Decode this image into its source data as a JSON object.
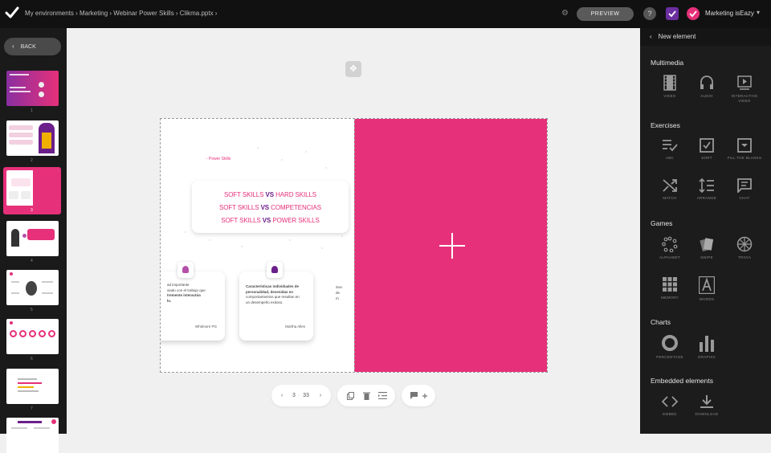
{
  "topbar": {
    "breadcrumb": "My environments › Marketing › Webinar Power Skills › Clikma.pptx ›",
    "preview_label": "PREVIEW",
    "help_label": "?",
    "user_name": "Marketing isEazy"
  },
  "left_panel": {
    "back_label": "BACK",
    "slides": [
      {
        "num": "1"
      },
      {
        "num": "2"
      },
      {
        "num": "3"
      },
      {
        "num": "4"
      },
      {
        "num": "5"
      },
      {
        "num": "6"
      },
      {
        "num": "7"
      }
    ]
  },
  "slide": {
    "tag": "- Power Skills",
    "line1_a": "SOFT SKILLS ",
    "line1_b": "VS",
    "line1_c": " HARD SKILLS",
    "line2_a": "SOFT SKILLS ",
    "line2_b": "VS",
    "line2_c": " COMPETENCIAS",
    "line3_a": "SOFT SKILLS ",
    "line3_b": "VS",
    "line3_c": " POWER SKILLS",
    "card1_text1": "ad importante",
    "card1_text2": "viado con el trabajo que",
    "card1_text3": "tremente interactúa",
    "card1_text4": "lo.",
    "card1_author": "Whitmore PG",
    "card2_text1": "Características individuales de",
    "card2_text2": "personalidad, devenidas en",
    "card2_text3": "comportamientos que resultan en",
    "card2_text4": "un desempeño exitoso.",
    "card2_author": "Martha Alles",
    "card3_text1": "Son",
    "card3_text2": "de",
    "card3_text3": "m"
  },
  "pager": {
    "current": "3",
    "total": "33"
  },
  "right_panel": {
    "header": "New element",
    "sections": {
      "multimedia": "Multimedia",
      "exercises": "Exercises",
      "games": "Games",
      "charts": "Charts",
      "embedded": "Embedded elements"
    },
    "tools": {
      "video": "VIDEO",
      "audio": "AUDIO",
      "interactive_video": "INTERACTIVE VIDEO",
      "abc": "ABC",
      "sort": "SORT",
      "fill_blanks": "FILL THE BLANKS",
      "match": "MATCH",
      "arrange": "ARRANGE",
      "chat": "CHAT",
      "alphabet": "ALPHABET",
      "swipe": "SWIPE",
      "trivia": "TRIVIA",
      "memory": "MEMORY",
      "words": "WORDS",
      "percentage": "PERCENTAGE",
      "graphic": "GRAPHIC",
      "embed": "EMBED",
      "download": "DOWNLOAD"
    }
  },
  "colors": {
    "accent": "#e6307a",
    "purple": "#6b1f8a"
  }
}
